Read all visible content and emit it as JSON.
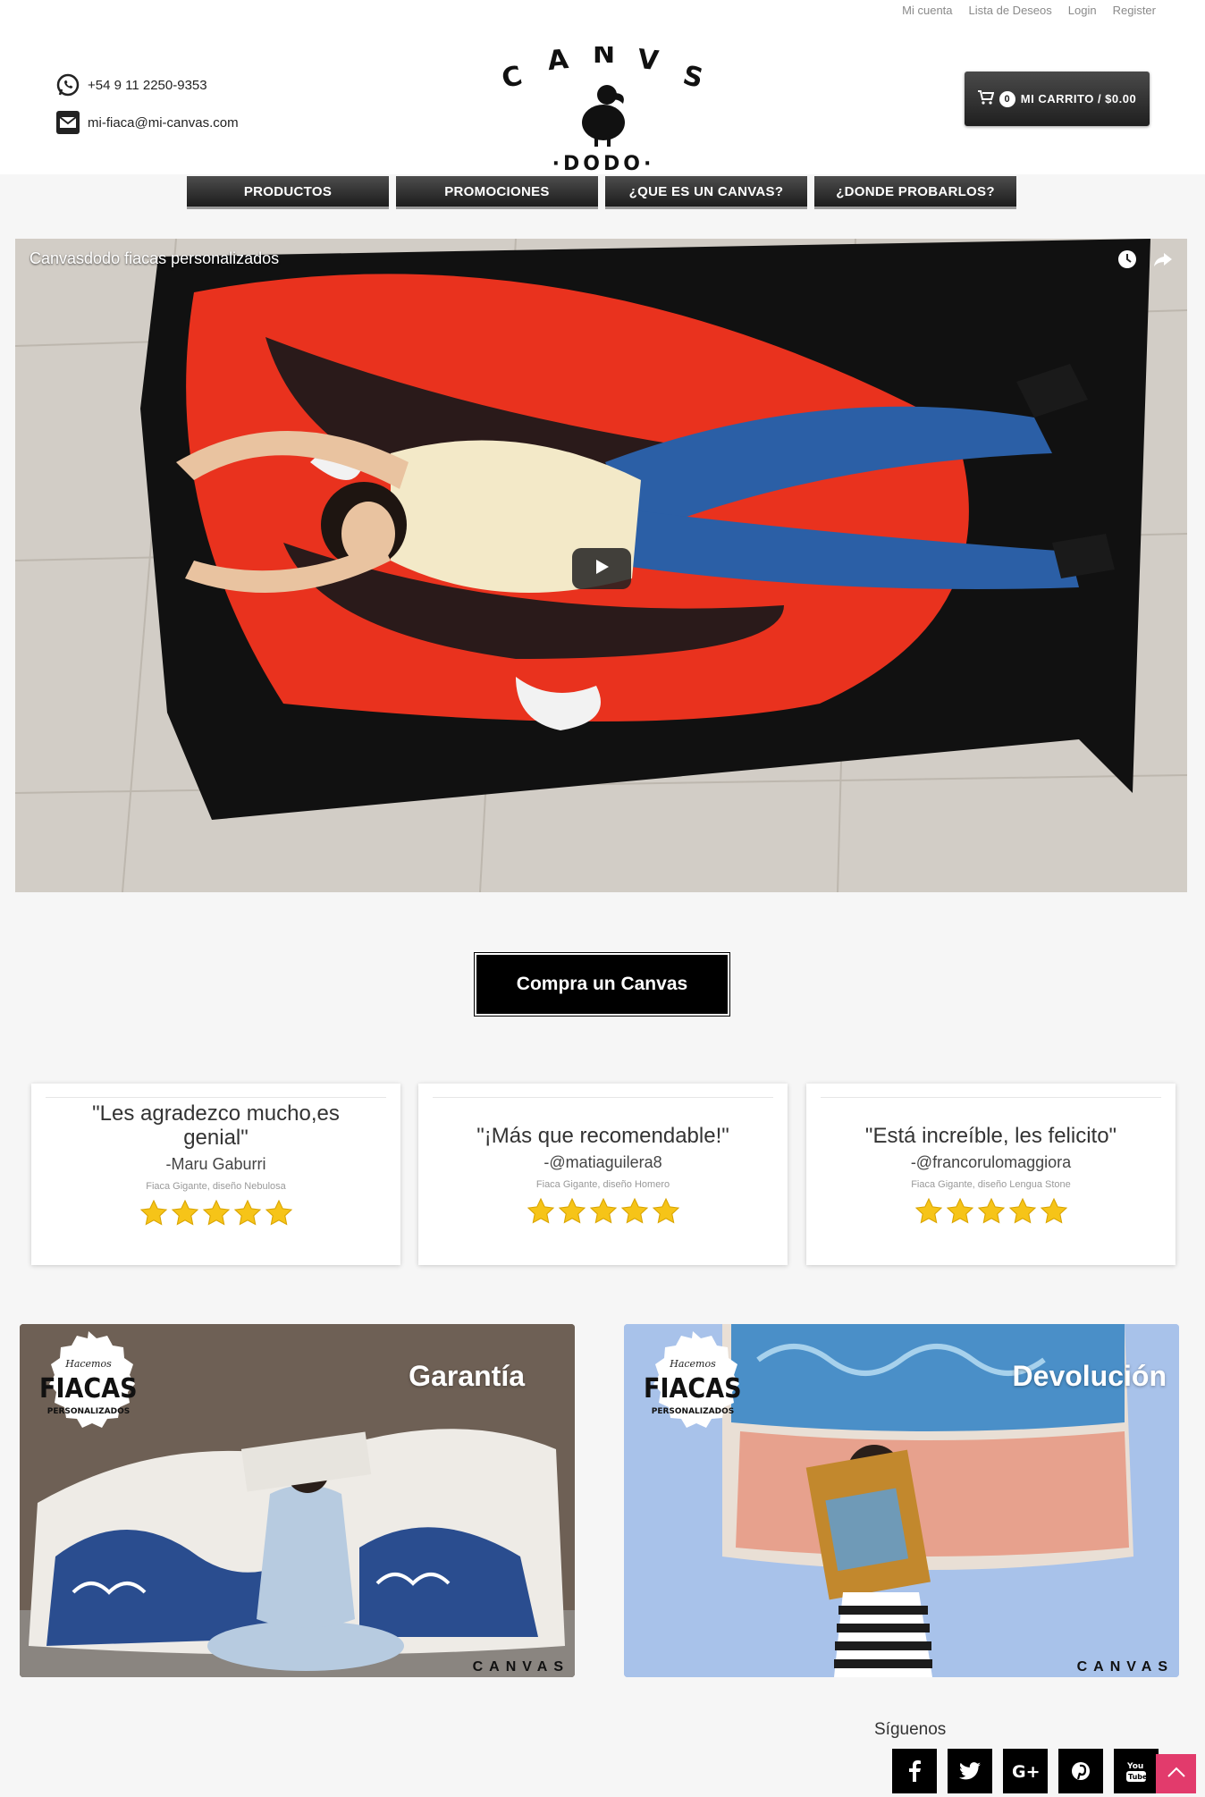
{
  "topnav": [
    "Mi cuenta",
    "Lista de Deseos",
    "Login",
    "Register"
  ],
  "contact": {
    "phone": "+54 9 11 2250-9353",
    "email": "mi-fiaca@mi-canvas.com"
  },
  "logo": {
    "top": "CANVAS",
    "bottom": "·DODO·"
  },
  "cart": {
    "count": "0",
    "label": "MI CARRITO / $0.00"
  },
  "mainnav": [
    "PRODUCTOS",
    "PROMOCIONES",
    "¿QUE ES UN CANVAS?",
    "¿DONDE PROBARLOS?"
  ],
  "video": {
    "title": "Canvasdodo fiacas personalizados"
  },
  "cta": "Compra un Canvas",
  "testimonials": [
    {
      "quote": "\"Les agradezco mucho,es genial\"",
      "author": "-Maru Gaburri",
      "note": "Fiaca Gigante, diseño Nebulosa",
      "stars": 5
    },
    {
      "quote": "\"¡Más que recomendable!\"",
      "author": "-@matiaguilera8",
      "note": "Fiaca Gigante, diseño Homero",
      "stars": 5
    },
    {
      "quote": "\"Está increíble, les felicito\"",
      "author": "-@francorulomaggiora",
      "note": "Fiaca Gigante, diseño Lengua Stone",
      "stars": 5
    }
  ],
  "promos": [
    {
      "title": "Garantía",
      "badge_top": "Hacemos",
      "badge_main": "FIACAS",
      "badge_sub": "PERSONALIZADOS",
      "mark": "CANVAS"
    },
    {
      "title": "Devolución",
      "badge_top": "Hacemos",
      "badge_main": "FIACAS",
      "badge_sub": "PERSONALIZADOS",
      "mark": "CANVAS"
    }
  ],
  "social": {
    "heading": "Síguenos"
  },
  "colors": {
    "accent": "#e23b6c",
    "dark": "#1c1c1c",
    "star": "#f6c418"
  }
}
